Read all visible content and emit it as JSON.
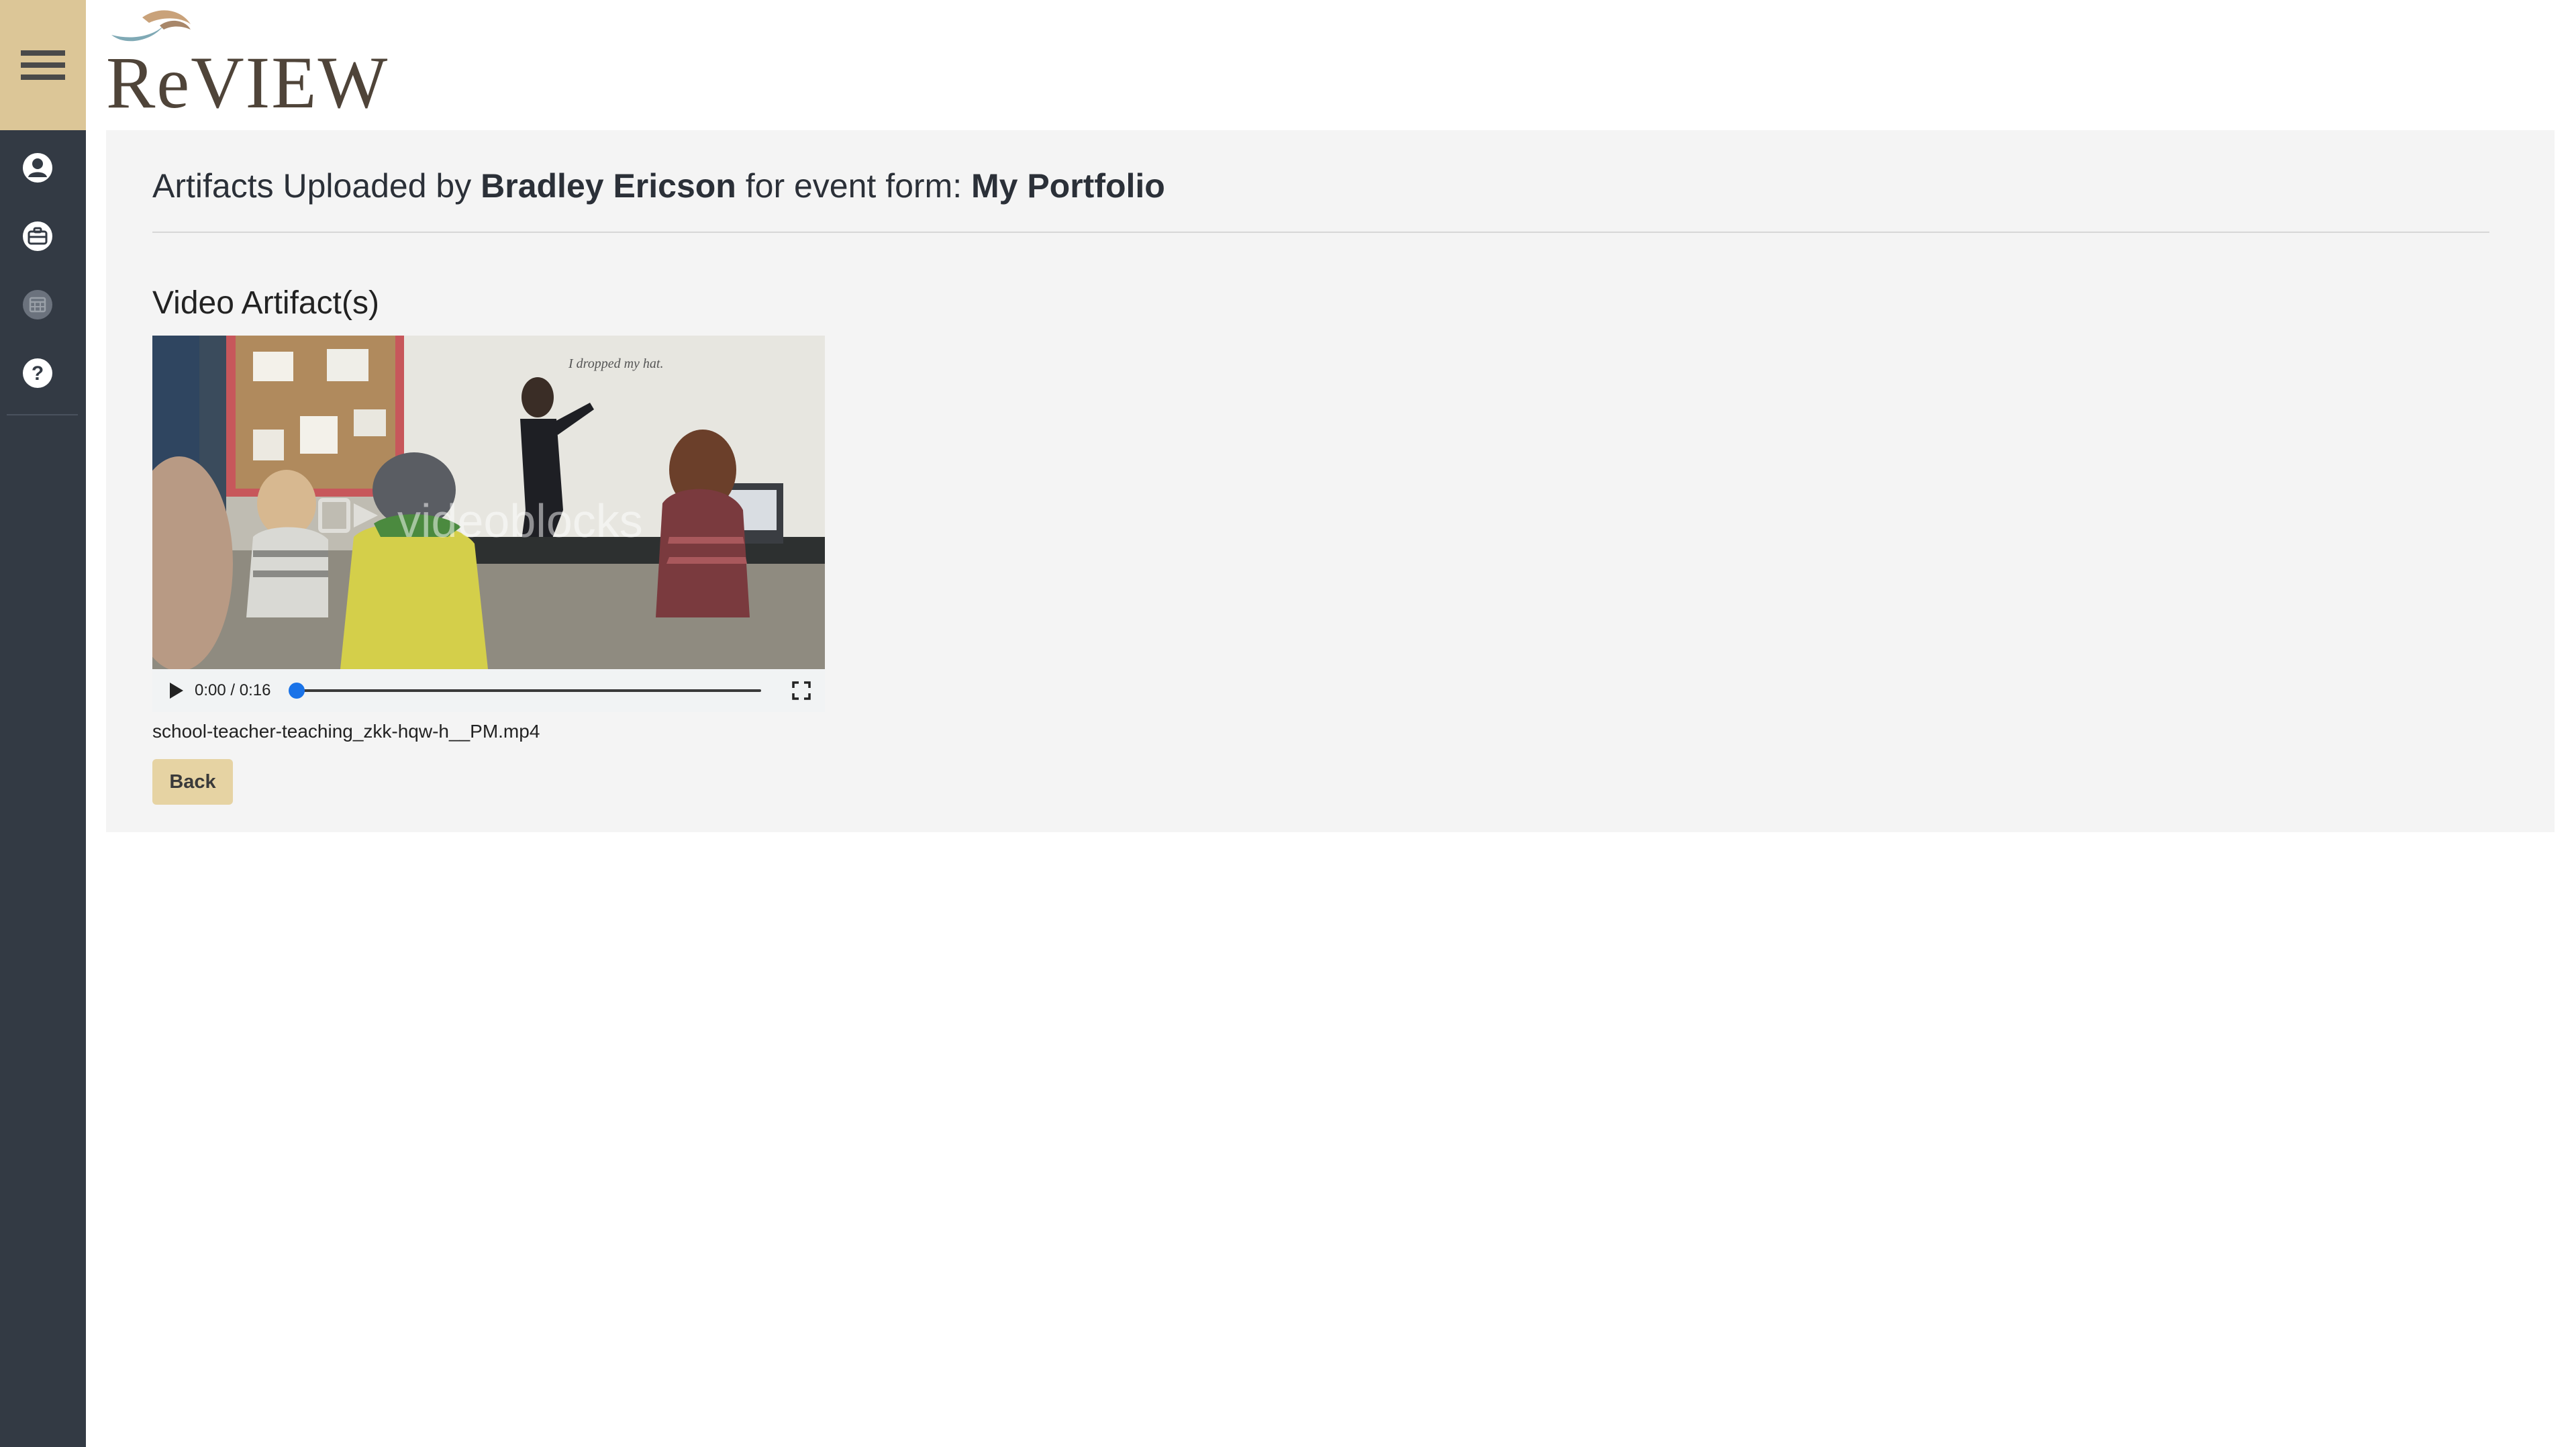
{
  "app": {
    "logo_text": "ReVIEW"
  },
  "sidebar": {
    "icons": [
      "hamburger-menu-icon",
      "user-icon",
      "briefcase-icon",
      "calendar-icon",
      "help-icon"
    ]
  },
  "header": {
    "title_prefix": "Artifacts Uploaded by ",
    "user_name": "Bradley Ericson",
    "title_middle": " for event form: ",
    "form_name": "My Portfolio"
  },
  "section": {
    "title": "Video Artifact(s)"
  },
  "video": {
    "watermark": "videoblocks",
    "board_text": "I dropped my hat.",
    "time_display": "0:00 / 0:16",
    "progress": 0,
    "file_name": "school-teacher-teaching_zkk-hqw-h__PM.mp4"
  },
  "actions": {
    "back_label": "Back"
  },
  "colors": {
    "sidebar_bg": "#333a44",
    "accent_gold": "#dcc697",
    "button_bg": "#e6d3a3",
    "panel_bg": "#f4f4f4",
    "progress_blue": "#1a73e8"
  }
}
